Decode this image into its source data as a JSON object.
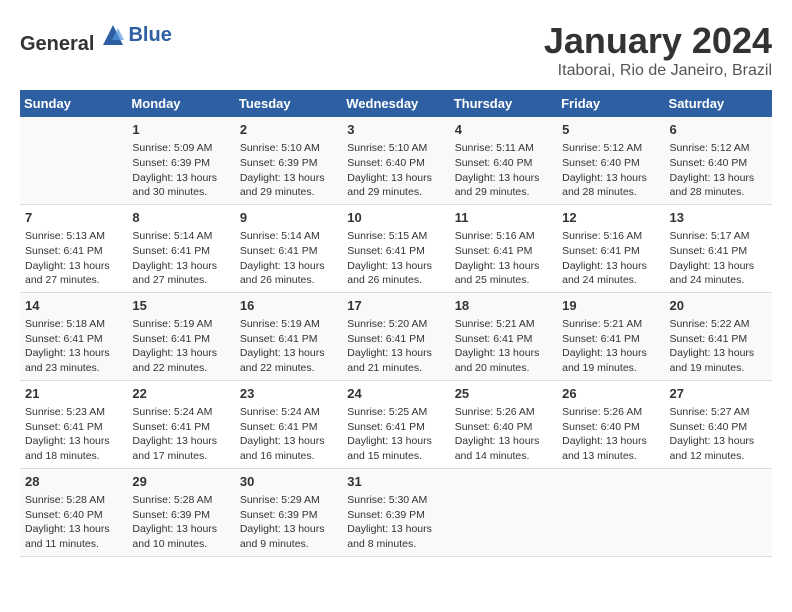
{
  "logo": {
    "text_general": "General",
    "text_blue": "Blue"
  },
  "title": "January 2024",
  "subtitle": "Itaborai, Rio de Janeiro, Brazil",
  "header": {
    "days": [
      "Sunday",
      "Monday",
      "Tuesday",
      "Wednesday",
      "Thursday",
      "Friday",
      "Saturday"
    ]
  },
  "weeks": [
    {
      "cells": [
        {
          "day": "",
          "content": ""
        },
        {
          "day": "1",
          "content": "Sunrise: 5:09 AM\nSunset: 6:39 PM\nDaylight: 13 hours\nand 30 minutes."
        },
        {
          "day": "2",
          "content": "Sunrise: 5:10 AM\nSunset: 6:39 PM\nDaylight: 13 hours\nand 29 minutes."
        },
        {
          "day": "3",
          "content": "Sunrise: 5:10 AM\nSunset: 6:40 PM\nDaylight: 13 hours\nand 29 minutes."
        },
        {
          "day": "4",
          "content": "Sunrise: 5:11 AM\nSunset: 6:40 PM\nDaylight: 13 hours\nand 29 minutes."
        },
        {
          "day": "5",
          "content": "Sunrise: 5:12 AM\nSunset: 6:40 PM\nDaylight: 13 hours\nand 28 minutes."
        },
        {
          "day": "6",
          "content": "Sunrise: 5:12 AM\nSunset: 6:40 PM\nDaylight: 13 hours\nand 28 minutes."
        }
      ]
    },
    {
      "cells": [
        {
          "day": "7",
          "content": "Sunrise: 5:13 AM\nSunset: 6:41 PM\nDaylight: 13 hours\nand 27 minutes."
        },
        {
          "day": "8",
          "content": "Sunrise: 5:14 AM\nSunset: 6:41 PM\nDaylight: 13 hours\nand 27 minutes."
        },
        {
          "day": "9",
          "content": "Sunrise: 5:14 AM\nSunset: 6:41 PM\nDaylight: 13 hours\nand 26 minutes."
        },
        {
          "day": "10",
          "content": "Sunrise: 5:15 AM\nSunset: 6:41 PM\nDaylight: 13 hours\nand 26 minutes."
        },
        {
          "day": "11",
          "content": "Sunrise: 5:16 AM\nSunset: 6:41 PM\nDaylight: 13 hours\nand 25 minutes."
        },
        {
          "day": "12",
          "content": "Sunrise: 5:16 AM\nSunset: 6:41 PM\nDaylight: 13 hours\nand 24 minutes."
        },
        {
          "day": "13",
          "content": "Sunrise: 5:17 AM\nSunset: 6:41 PM\nDaylight: 13 hours\nand 24 minutes."
        }
      ]
    },
    {
      "cells": [
        {
          "day": "14",
          "content": "Sunrise: 5:18 AM\nSunset: 6:41 PM\nDaylight: 13 hours\nand 23 minutes."
        },
        {
          "day": "15",
          "content": "Sunrise: 5:19 AM\nSunset: 6:41 PM\nDaylight: 13 hours\nand 22 minutes."
        },
        {
          "day": "16",
          "content": "Sunrise: 5:19 AM\nSunset: 6:41 PM\nDaylight: 13 hours\nand 22 minutes."
        },
        {
          "day": "17",
          "content": "Sunrise: 5:20 AM\nSunset: 6:41 PM\nDaylight: 13 hours\nand 21 minutes."
        },
        {
          "day": "18",
          "content": "Sunrise: 5:21 AM\nSunset: 6:41 PM\nDaylight: 13 hours\nand 20 minutes."
        },
        {
          "day": "19",
          "content": "Sunrise: 5:21 AM\nSunset: 6:41 PM\nDaylight: 13 hours\nand 19 minutes."
        },
        {
          "day": "20",
          "content": "Sunrise: 5:22 AM\nSunset: 6:41 PM\nDaylight: 13 hours\nand 19 minutes."
        }
      ]
    },
    {
      "cells": [
        {
          "day": "21",
          "content": "Sunrise: 5:23 AM\nSunset: 6:41 PM\nDaylight: 13 hours\nand 18 minutes."
        },
        {
          "day": "22",
          "content": "Sunrise: 5:24 AM\nSunset: 6:41 PM\nDaylight: 13 hours\nand 17 minutes."
        },
        {
          "day": "23",
          "content": "Sunrise: 5:24 AM\nSunset: 6:41 PM\nDaylight: 13 hours\nand 16 minutes."
        },
        {
          "day": "24",
          "content": "Sunrise: 5:25 AM\nSunset: 6:41 PM\nDaylight: 13 hours\nand 15 minutes."
        },
        {
          "day": "25",
          "content": "Sunrise: 5:26 AM\nSunset: 6:40 PM\nDaylight: 13 hours\nand 14 minutes."
        },
        {
          "day": "26",
          "content": "Sunrise: 5:26 AM\nSunset: 6:40 PM\nDaylight: 13 hours\nand 13 minutes."
        },
        {
          "day": "27",
          "content": "Sunrise: 5:27 AM\nSunset: 6:40 PM\nDaylight: 13 hours\nand 12 minutes."
        }
      ]
    },
    {
      "cells": [
        {
          "day": "28",
          "content": "Sunrise: 5:28 AM\nSunset: 6:40 PM\nDaylight: 13 hours\nand 11 minutes."
        },
        {
          "day": "29",
          "content": "Sunrise: 5:28 AM\nSunset: 6:39 PM\nDaylight: 13 hours\nand 10 minutes."
        },
        {
          "day": "30",
          "content": "Sunrise: 5:29 AM\nSunset: 6:39 PM\nDaylight: 13 hours\nand 9 minutes."
        },
        {
          "day": "31",
          "content": "Sunrise: 5:30 AM\nSunset: 6:39 PM\nDaylight: 13 hours\nand 8 minutes."
        },
        {
          "day": "",
          "content": ""
        },
        {
          "day": "",
          "content": ""
        },
        {
          "day": "",
          "content": ""
        }
      ]
    }
  ]
}
